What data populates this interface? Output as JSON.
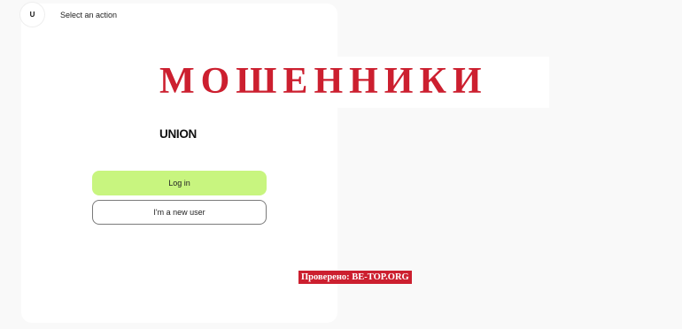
{
  "header": {
    "avatar_letter": "U",
    "title": "Select an action"
  },
  "brand": {
    "logo_text": "UNION"
  },
  "actions": {
    "login_label": "Log in",
    "new_user_label": "I'm a new user"
  },
  "overlay": {
    "warning_text": "МОШЕННИКИ",
    "verified_text": "Проверено: BE-TOP.ORG"
  },
  "colors": {
    "accent": "#c8f57f",
    "warning": "#cc1f2f"
  }
}
